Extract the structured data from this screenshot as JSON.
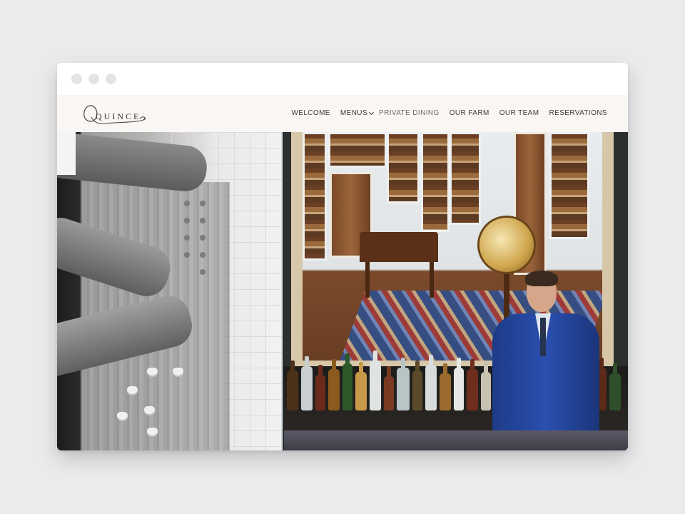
{
  "brand": {
    "logo_text": "QUINCE"
  },
  "nav": {
    "items": [
      {
        "label": "WELCOME"
      },
      {
        "label": "MENUS"
      },
      {
        "label": "PRIVATE DINING"
      },
      {
        "label": "OUR FARM"
      },
      {
        "label": "OUR TEAM"
      },
      {
        "label": "RESERVATIONS"
      }
    ]
  },
  "colors": {
    "page_background": "#eaebed",
    "header_background": "#faf6f2",
    "nav_text": "#3d3a38",
    "nav_text_muted": "#6f6a66",
    "suit_blue": "#2a4fb0"
  },
  "icons": {
    "window_controls": [
      "window-dot-icon",
      "window-dot-icon",
      "window-dot-icon"
    ],
    "menus_dropdown": "chevron-down-icon",
    "logo_swash": "logo-swash-icon"
  }
}
